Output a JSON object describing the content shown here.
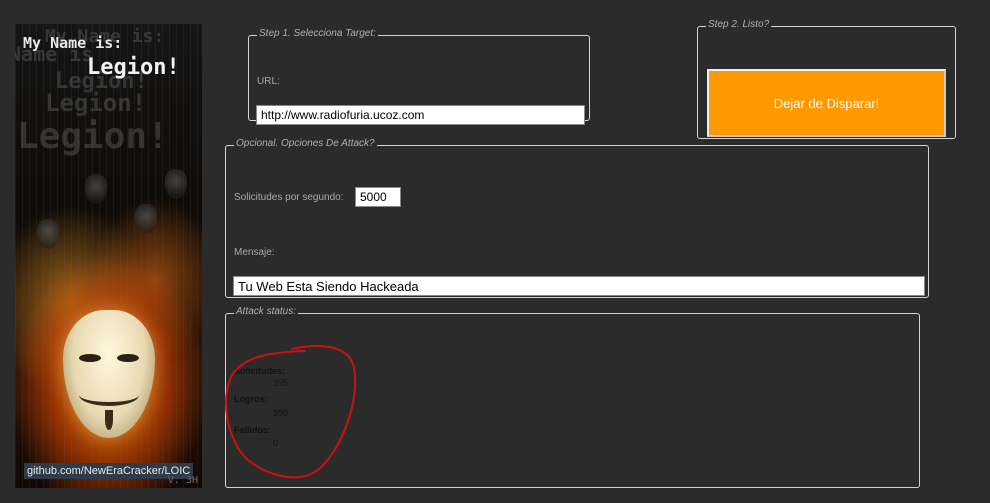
{
  "banner": {
    "header_line1": "My Name is:",
    "header_line2": "Legion!",
    "github_link": "github.com/NewEraCracker/LOIC",
    "version": "V. 3H"
  },
  "step1": {
    "legend": "Step 1. Selecciona Target:",
    "url_label": "URL:",
    "url_value": "http://www.radiofuria.ucoz.com"
  },
  "step2": {
    "legend": "Step 2. Listo?",
    "fire_button": "Dejar de Disparar!"
  },
  "options": {
    "legend": "Opcional. Opciones De Attack?",
    "rate_label": "Solicitudes por segundo:",
    "rate_value": "5000",
    "message_label": "Mensaje:",
    "message_value": "Tu Web Esta Siendo Hackeada"
  },
  "status": {
    "legend": "Attack status:",
    "requests_label": "Solicitudes:",
    "requests_value": "395",
    "success_label": "Logros:",
    "success_value": "390",
    "failed_label": "Fallidos:",
    "failed_value": "0"
  },
  "colors": {
    "background": "#2b2b2b",
    "fire_button": "#ff9900",
    "annotation": "#cc1111"
  }
}
